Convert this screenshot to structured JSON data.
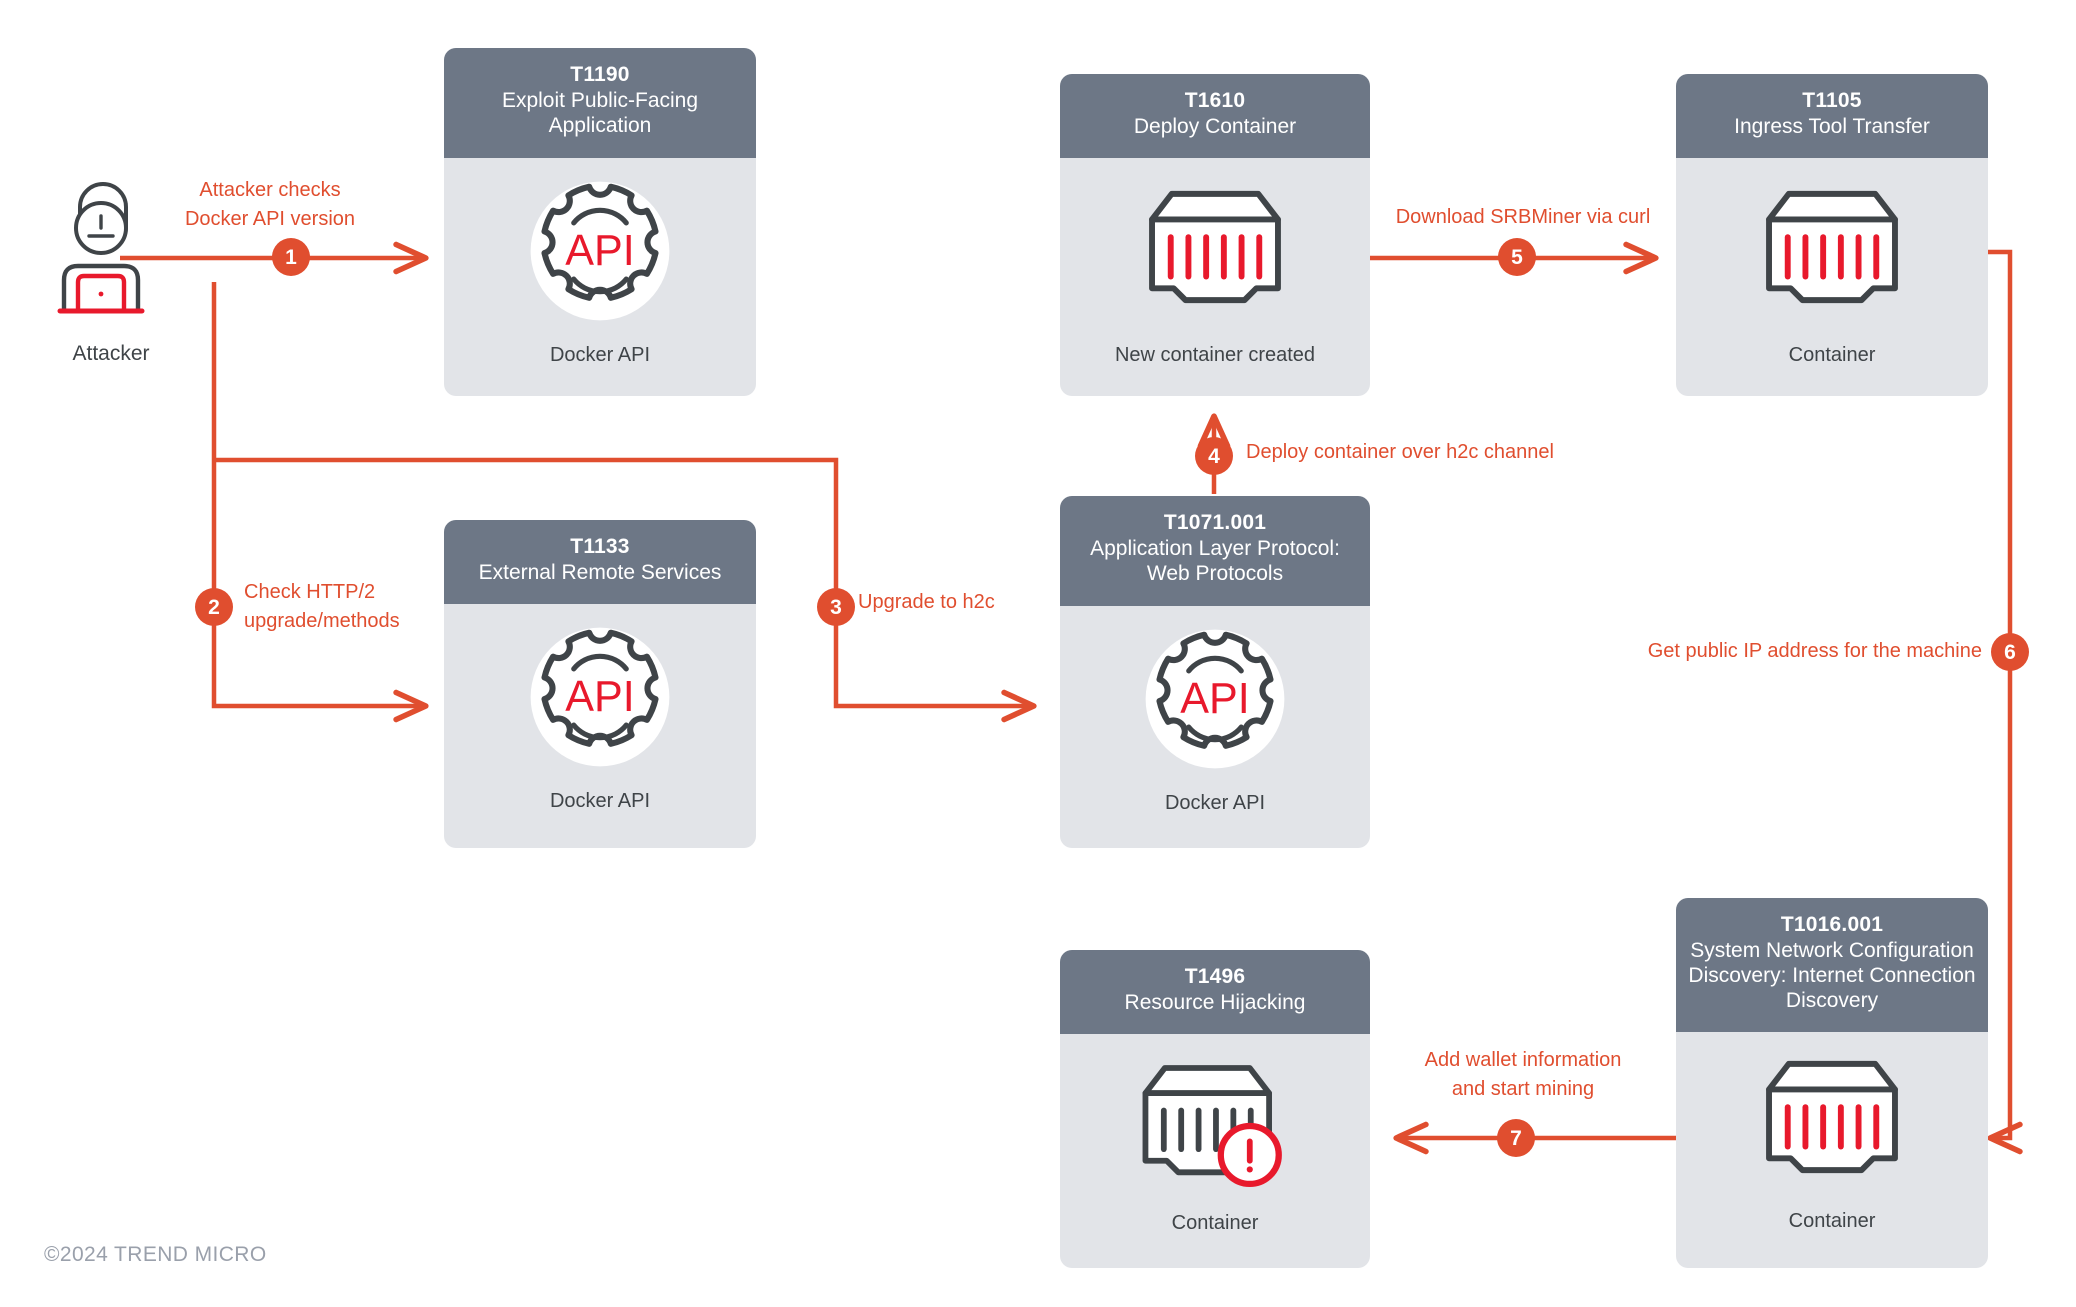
{
  "meta": {
    "copyright": "©2024 TREND MICRO",
    "accent_color": "#e04e2f",
    "header_color": "#6d7786",
    "card_body_color": "#e2e4e8",
    "icon_dark_color": "#3f4448",
    "icon_red_color": "#e8192c"
  },
  "actor": {
    "label": "Attacker",
    "icon": "attacker-person-laptop-icon"
  },
  "cards": [
    {
      "key": "t1190",
      "id": "T1190",
      "title": "Exploit Public-Facing\nApplication",
      "icon": "api-gear-icon",
      "caption": "Docker API"
    },
    {
      "key": "t1133",
      "id": "T1133",
      "title": "External Remote Services",
      "icon": "api-gear-icon",
      "caption": "Docker API"
    },
    {
      "key": "t1610",
      "id": "T1610",
      "title": "Deploy Container",
      "icon": "container-icon",
      "caption": "New container created"
    },
    {
      "key": "t1071001",
      "id": "T1071.001",
      "title": "Application Layer Protocol:\nWeb Protocols",
      "icon": "api-gear-icon",
      "caption": "Docker API"
    },
    {
      "key": "t1105",
      "id": "T1105",
      "title": "Ingress Tool Transfer",
      "icon": "container-icon",
      "caption": "Container"
    },
    {
      "key": "t1016001",
      "id": "T1016.001",
      "title": "System Network\nConfiguration Discovery:\nInternet Connection Discovery",
      "icon": "container-icon",
      "caption": "Container"
    },
    {
      "key": "t1496",
      "id": "T1496",
      "title": "Resource Hijacking",
      "icon": "container-alert-icon",
      "caption": "Container"
    }
  ],
  "steps": [
    {
      "number": "1",
      "label": "Attacker checks\nDocker API version"
    },
    {
      "number": "2",
      "label": "Check HTTP/2\nupgrade/methods"
    },
    {
      "number": "3",
      "label": "Upgrade to h2c"
    },
    {
      "number": "4",
      "label": "Deploy container over h2c channel"
    },
    {
      "number": "5",
      "label": "Download SRBMiner via curl"
    },
    {
      "number": "6",
      "label": "Get public IP address for the machine"
    },
    {
      "number": "7",
      "label": "Add wallet information\nand start mining"
    }
  ]
}
